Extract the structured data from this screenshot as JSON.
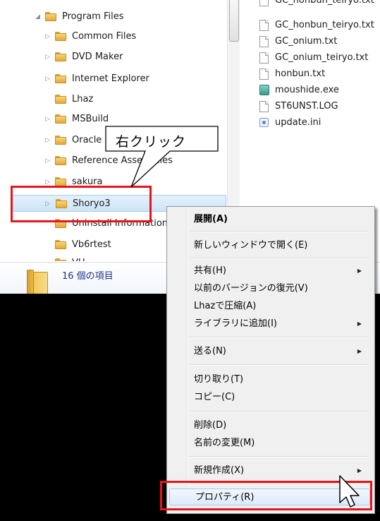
{
  "tree": {
    "items": [
      {
        "label": "Program Files",
        "expanded": true
      },
      {
        "label": "Common Files",
        "expanded": false
      },
      {
        "label": "DVD Maker",
        "expanded": false
      },
      {
        "label": "Internet Explorer",
        "expanded": false
      },
      {
        "label": "Lhaz",
        "expanded": null
      },
      {
        "label": "MSBuild",
        "expanded": false
      },
      {
        "label": "Oracle",
        "expanded": false
      },
      {
        "label": "Reference Assemblies",
        "expanded": false
      },
      {
        "label": "sakura",
        "expanded": false
      },
      {
        "label": "Shoryo3",
        "expanded": false,
        "selected": true
      },
      {
        "label": "Uninstall Information",
        "expanded": null
      },
      {
        "label": "Vb6rtest",
        "expanded": null
      },
      {
        "label": "VH",
        "expanded": null
      }
    ]
  },
  "files": [
    {
      "label": "GC_honbun_teiryo.txt",
      "icon": "text-file-icon"
    },
    {
      "label": "GC_onium.txt",
      "icon": "text-file-icon"
    },
    {
      "label": "GC_onium_teiryo.txt",
      "icon": "text-file-icon"
    },
    {
      "label": "honbun.txt",
      "icon": "text-file-icon"
    },
    {
      "label": "moushide.exe",
      "icon": "exe-icon"
    },
    {
      "label": "ST6UNST.LOG",
      "icon": "text-file-icon"
    },
    {
      "label": "update.ini",
      "icon": "settings-file-icon"
    }
  ],
  "details": {
    "count_text": "16 個の項目"
  },
  "callout": {
    "text": "右クリック"
  },
  "context_menu": {
    "items": [
      {
        "label": "展開(A)",
        "bold": true,
        "submenu": false
      },
      {
        "label": "新しいウィンドウで開く(E)",
        "submenu": false
      },
      {
        "label": "共有(H)",
        "submenu": true
      },
      {
        "label": "以前のバージョンの復元(V)",
        "submenu": false
      },
      {
        "label": "Lhazで圧縮(A)",
        "submenu": false
      },
      {
        "label": "ライブラリに追加(I)",
        "submenu": true
      },
      {
        "label": "送る(N)",
        "submenu": true
      },
      {
        "label": "切り取り(T)",
        "submenu": false
      },
      {
        "label": "コピー(C)",
        "submenu": false
      },
      {
        "label": "削除(D)",
        "submenu": false
      },
      {
        "label": "名前の変更(M)",
        "submenu": false
      },
      {
        "label": "新規作成(X)",
        "submenu": true
      },
      {
        "label": "プロパティ(R)",
        "submenu": false,
        "highlighted": true
      }
    ]
  },
  "colors": {
    "highlight": "#e8141b",
    "menu_bg": "#f0f0f0"
  }
}
